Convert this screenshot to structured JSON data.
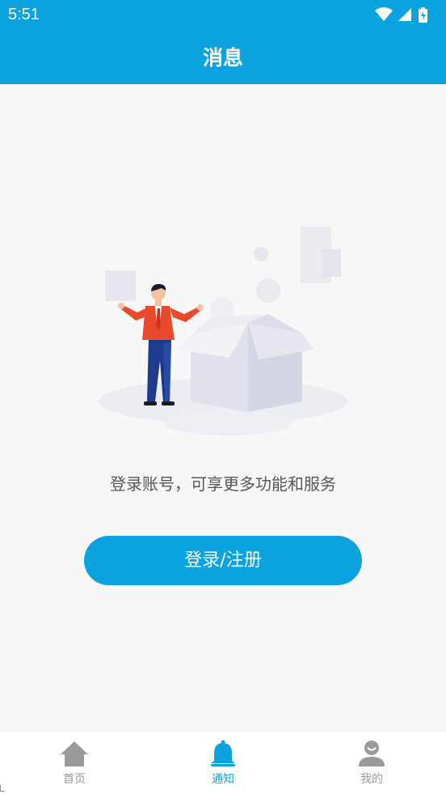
{
  "status_bar": {
    "time": "5:51"
  },
  "header": {
    "title": "消息"
  },
  "main": {
    "prompt": "登录账号，可享更多功能和服务",
    "login_button_label": "登录/注册"
  },
  "tab_bar": {
    "tabs": [
      {
        "label": "首页",
        "icon": "home-icon",
        "active": false
      },
      {
        "label": "通知",
        "icon": "bell-icon",
        "active": true
      },
      {
        "label": "我的",
        "icon": "user-icon",
        "active": false
      }
    ]
  },
  "colors": {
    "accent": "#0aa3e0",
    "inactive": "#9a9a9a",
    "background": "#f8f8f8"
  }
}
